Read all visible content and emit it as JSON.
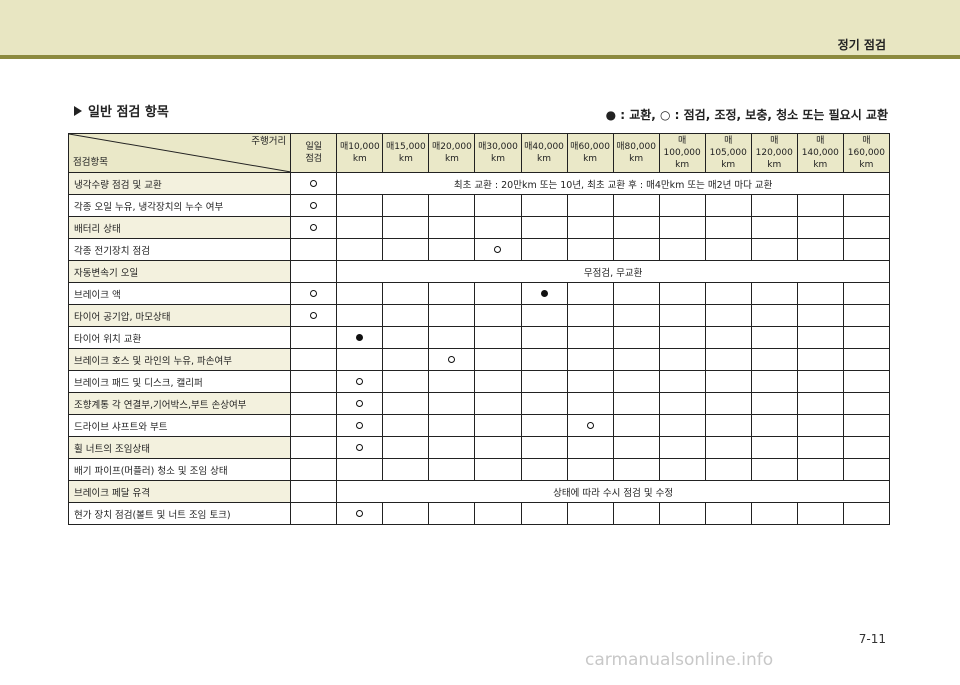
{
  "header": {
    "section_title": "정기 점검"
  },
  "heading": {
    "title": "일반 점검 항목"
  },
  "legend": {
    "text": "● : 교환, ○ : 점검, 조정, 보충, 청소 또는 필요시 교환"
  },
  "table": {
    "corner_top": "주행거리",
    "corner_bottom": "점검항목",
    "columns": [
      [
        "일일",
        "점검"
      ],
      [
        "매10,000",
        "km"
      ],
      [
        "매15,000",
        "km"
      ],
      [
        "매20,000",
        "km"
      ],
      [
        "매30,000",
        "km"
      ],
      [
        "매40,000",
        "km"
      ],
      [
        "매60,000",
        "km"
      ],
      [
        "매80,000",
        "km"
      ],
      [
        "매100,000",
        "km"
      ],
      [
        "매105,000",
        "km"
      ],
      [
        "매120,000",
        "km"
      ],
      [
        "매140,000",
        "km"
      ],
      [
        "매160,000",
        "km"
      ]
    ],
    "rows": [
      {
        "item": "냉각수량 점검 및 교환",
        "daily": "circle",
        "span_text": "최초 교환 : 20만km 또는 10년, 최초 교환 후 : 매4만km 또는 매2년 마다 교환"
      },
      {
        "item": "각종 오일 누유, 냉각장치의 누수 여부",
        "daily": "circle"
      },
      {
        "item": "배터리 상태",
        "daily": "circle"
      },
      {
        "item": "각종 전기장치 점검",
        "marks": {
          "4": "circle"
        }
      },
      {
        "item": "자동변속기 오일",
        "span_text": "무점검, 무교환"
      },
      {
        "item": "브레이크 액",
        "daily": "circle",
        "marks": {
          "5": "dot"
        }
      },
      {
        "item": "타이어 공기압, 마모상태",
        "daily": "circle"
      },
      {
        "item": "타이어 위치 교환",
        "marks": {
          "1": "dot"
        }
      },
      {
        "item": "브레이크 호스 및 라인의 누유, 파손여부",
        "marks": {
          "3": "circle"
        }
      },
      {
        "item": "브레이크 패드 및 디스크, 캘리퍼",
        "marks": {
          "1": "circle"
        }
      },
      {
        "item": "조향계통 각 연결부,기어박스,부트 손상여부",
        "marks": {
          "1": "circle"
        }
      },
      {
        "item": "드라이브 샤프트와 부트",
        "marks": {
          "1": "circle",
          "6": "circle"
        }
      },
      {
        "item": "휠 너트의 조임상태",
        "marks": {
          "1": "circle"
        }
      },
      {
        "item": "배기 파이프(머플러) 청소 및 조임 상태"
      },
      {
        "item": "브레이크 페달 유격",
        "span_text": "상태에 따라 수시 점검 및 수정"
      },
      {
        "item": "현가 장치 점검(볼트 및 너트 조임 토크)",
        "marks": {
          "1": "circle"
        }
      }
    ]
  },
  "page": {
    "number": "7-11"
  },
  "watermark": {
    "text": "carmanualsonline.info"
  }
}
